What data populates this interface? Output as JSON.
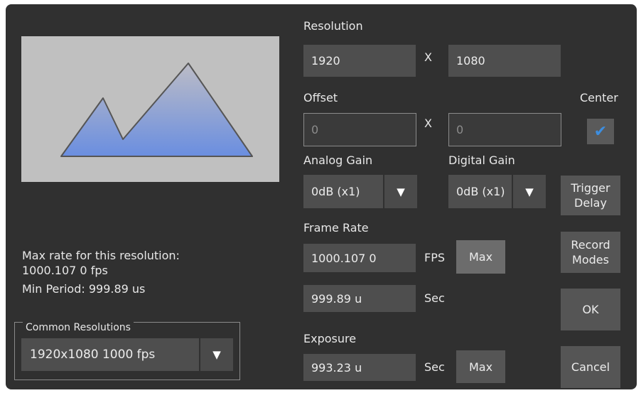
{
  "resolution": {
    "label": "Resolution",
    "width": "1920",
    "x_sep": "X",
    "height": "1080"
  },
  "offset": {
    "label": "Offset",
    "x": "0",
    "x_sep": "X",
    "y": "0"
  },
  "center": {
    "label": "Center",
    "checked": true
  },
  "analog_gain": {
    "label": "Analog Gain",
    "value": "0dB (x1)"
  },
  "digital_gain": {
    "label": "Digital Gain",
    "value": "0dB (x1)"
  },
  "trigger_delay": {
    "line1": "Trigger",
    "line2": "Delay"
  },
  "frame_rate": {
    "label": "Frame Rate",
    "value": "1000.107 0",
    "unit": "FPS",
    "max_label": "Max"
  },
  "period": {
    "value": "999.89 u",
    "unit": "Sec"
  },
  "record_modes": {
    "line1": "Record",
    "line2": "Modes"
  },
  "ok_label": "OK",
  "info": {
    "line1": "Max rate for this resolution:",
    "line2": "1000.107 0 fps",
    "line3": "Min Period: 999.89 us"
  },
  "exposure": {
    "label": "Exposure",
    "value": "993.23 u",
    "unit": "Sec",
    "max_label": "Max"
  },
  "cancel_label": "Cancel",
  "common_resolutions": {
    "title": "Common Resolutions",
    "value": "1920x1080 1000 fps"
  },
  "icons": {
    "dropdown": "triangle-down-icon",
    "check": "checkmark-icon",
    "preview": "mountain-image-icon"
  },
  "colors": {
    "window": "#303030",
    "field": "#4e4e4e",
    "button": "#555555",
    "check": "#3d8ee0"
  }
}
